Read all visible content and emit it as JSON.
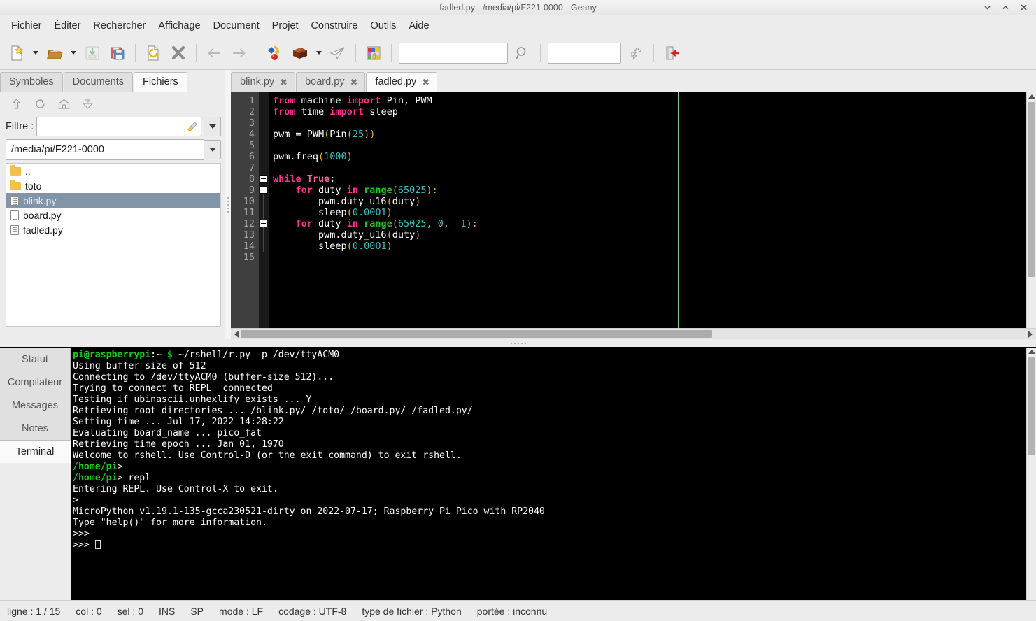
{
  "window": {
    "title": "fadled.py - /media/pi/F221-0000 - Geany",
    "controls": [
      {
        "name": "minimize-button",
        "glyph": "chevron-down-icon"
      },
      {
        "name": "maximize-button",
        "glyph": "chevron-up-icon"
      },
      {
        "name": "close-button",
        "glyph": "close-icon"
      }
    ]
  },
  "menubar": {
    "items": [
      {
        "label": "Fichier"
      },
      {
        "label": "Éditer"
      },
      {
        "label": "Rechercher"
      },
      {
        "label": "Affichage"
      },
      {
        "label": "Document"
      },
      {
        "label": "Projet"
      },
      {
        "label": "Construire"
      },
      {
        "label": "Outils"
      },
      {
        "label": "Aide"
      }
    ]
  },
  "toolbar": {
    "buttons": [
      {
        "name": "new-document-button",
        "icon": "new-file-icon"
      },
      {
        "name": "new-document-menu-button",
        "icon": "chevron-down-icon"
      },
      {
        "name": "open-document-button",
        "icon": "open-folder-icon"
      },
      {
        "name": "open-recent-menu-button",
        "icon": "chevron-down-icon"
      },
      {
        "name": "save-button",
        "icon": "save-icon"
      },
      {
        "name": "save-all-button",
        "icon": "save-all-icon"
      },
      {
        "name": "reload-button",
        "icon": "revert-icon"
      },
      {
        "name": "close-document-button",
        "icon": "close-x-icon"
      },
      {
        "name": "navigate-back-button",
        "icon": "arrow-left-icon"
      },
      {
        "name": "navigate-forward-button",
        "icon": "arrow-right-icon"
      },
      {
        "name": "compile-button",
        "icon": "compile-icon"
      },
      {
        "name": "build-button",
        "icon": "build-brick-icon"
      },
      {
        "name": "build-menu-button",
        "icon": "chevron-down-icon"
      },
      {
        "name": "run-button",
        "icon": "run-paperplane-icon"
      },
      {
        "name": "color-chooser-button",
        "icon": "color-palette-icon"
      },
      {
        "name": "quit-button",
        "icon": "quit-door-icon"
      }
    ],
    "search_entry": {
      "value": "",
      "placeholder": ""
    },
    "goto_entry": {
      "value": "",
      "placeholder": ""
    },
    "find_button": {
      "name": "find-icon"
    },
    "jump-to_button": {
      "name": "jump-to-icon"
    }
  },
  "sidebar": {
    "tabs": [
      {
        "label": "Symboles",
        "active": false
      },
      {
        "label": "Documents",
        "active": false
      },
      {
        "label": "Fichiers",
        "active": true
      }
    ],
    "toolbar_icons": [
      {
        "name": "go-up-icon"
      },
      {
        "name": "refresh-icon"
      },
      {
        "name": "home-icon"
      },
      {
        "name": "locate-current-file-icon"
      }
    ],
    "filter": {
      "label": "Filtre :",
      "value": "",
      "placeholder": ""
    },
    "path": {
      "value": "/media/pi/F221-0000"
    },
    "files": [
      {
        "name": "..",
        "type": "folder",
        "selected": false
      },
      {
        "name": "toto",
        "type": "folder",
        "selected": false
      },
      {
        "name": "blink.py",
        "type": "file",
        "selected": true
      },
      {
        "name": "board.py",
        "type": "file",
        "selected": false
      },
      {
        "name": "fadled.py",
        "type": "file",
        "selected": false
      }
    ]
  },
  "editor": {
    "tabs": [
      {
        "label": "blink.py",
        "active": false,
        "close": "✖"
      },
      {
        "label": "board.py",
        "active": false,
        "close": "✖"
      },
      {
        "label": "fadled.py",
        "active": true,
        "close": "✖"
      }
    ],
    "line_numbers": [
      "1",
      "2",
      "3",
      "4",
      "5",
      "6",
      "7",
      "8",
      "9",
      "10",
      "11",
      "12",
      "13",
      "14",
      "15"
    ],
    "code_lines": [
      {
        "n": 1,
        "tokens": [
          {
            "t": "from",
            "c": "kw"
          },
          {
            "t": " machine ",
            "c": "plain"
          },
          {
            "t": "import",
            "c": "kw"
          },
          {
            "t": " Pin, PWM",
            "c": "plain"
          }
        ]
      },
      {
        "n": 2,
        "tokens": [
          {
            "t": "from",
            "c": "kw"
          },
          {
            "t": " time ",
            "c": "plain"
          },
          {
            "t": "import",
            "c": "kw"
          },
          {
            "t": " sleep",
            "c": "plain"
          }
        ]
      },
      {
        "n": 3,
        "tokens": []
      },
      {
        "n": 4,
        "tokens": [
          {
            "t": "pwm = PWM",
            "c": "plain"
          },
          {
            "t": "(",
            "c": "op"
          },
          {
            "t": "Pin",
            "c": "plain"
          },
          {
            "t": "(",
            "c": "op"
          },
          {
            "t": "25",
            "c": "num"
          },
          {
            "t": "))",
            "c": "op"
          }
        ]
      },
      {
        "n": 5,
        "tokens": []
      },
      {
        "n": 6,
        "tokens": [
          {
            "t": "pwm.freq",
            "c": "plain"
          },
          {
            "t": "(",
            "c": "op"
          },
          {
            "t": "1000",
            "c": "num"
          },
          {
            "t": ")",
            "c": "op"
          }
        ]
      },
      {
        "n": 7,
        "tokens": []
      },
      {
        "n": 8,
        "tokens": [
          {
            "t": "while",
            "c": "kw"
          },
          {
            "t": " ",
            "c": "plain"
          },
          {
            "t": "True",
            "c": "kw2"
          },
          {
            "t": ":",
            "c": "plain"
          }
        ]
      },
      {
        "n": 9,
        "tokens": [
          {
            "t": "    ",
            "c": "plain"
          },
          {
            "t": "for",
            "c": "kw"
          },
          {
            "t": " duty ",
            "c": "plain"
          },
          {
            "t": "in",
            "c": "kw"
          },
          {
            "t": " ",
            "c": "plain"
          },
          {
            "t": "range",
            "c": "bi"
          },
          {
            "t": "(",
            "c": "op"
          },
          {
            "t": "65025",
            "c": "num"
          },
          {
            "t": "):",
            "c": "op"
          }
        ]
      },
      {
        "n": 10,
        "tokens": [
          {
            "t": "        pwm.duty_u16",
            "c": "plain"
          },
          {
            "t": "(",
            "c": "op"
          },
          {
            "t": "duty",
            "c": "plain"
          },
          {
            "t": ")",
            "c": "op"
          }
        ]
      },
      {
        "n": 11,
        "tokens": [
          {
            "t": "        sleep",
            "c": "plain"
          },
          {
            "t": "(",
            "c": "op"
          },
          {
            "t": "0.0001",
            "c": "num"
          },
          {
            "t": ")",
            "c": "op"
          }
        ]
      },
      {
        "n": 12,
        "tokens": [
          {
            "t": "    ",
            "c": "plain"
          },
          {
            "t": "for",
            "c": "kw"
          },
          {
            "t": " duty ",
            "c": "plain"
          },
          {
            "t": "in",
            "c": "kw"
          },
          {
            "t": " ",
            "c": "plain"
          },
          {
            "t": "range",
            "c": "bi"
          },
          {
            "t": "(",
            "c": "op"
          },
          {
            "t": "65025",
            "c": "num"
          },
          {
            "t": ", ",
            "c": "op"
          },
          {
            "t": "0",
            "c": "num"
          },
          {
            "t": ", ",
            "c": "op"
          },
          {
            "t": "-1",
            "c": "num"
          },
          {
            "t": "):",
            "c": "op"
          }
        ]
      },
      {
        "n": 13,
        "tokens": [
          {
            "t": "        pwm.duty_u16",
            "c": "plain"
          },
          {
            "t": "(",
            "c": "op"
          },
          {
            "t": "duty",
            "c": "plain"
          },
          {
            "t": ")",
            "c": "op"
          }
        ]
      },
      {
        "n": 14,
        "tokens": [
          {
            "t": "        sleep",
            "c": "plain"
          },
          {
            "t": "(",
            "c": "op"
          },
          {
            "t": "0.0001",
            "c": "num"
          },
          {
            "t": ")",
            "c": "op"
          }
        ]
      },
      {
        "n": 15,
        "tokens": []
      }
    ],
    "fold_markers": [
      8,
      9,
      12
    ],
    "edge_marker_color": "#7fd07f"
  },
  "message_panel": {
    "tabs": [
      {
        "label": "Statut",
        "active": false
      },
      {
        "label": "Compilateur",
        "active": false
      },
      {
        "label": "Messages",
        "active": false
      },
      {
        "label": "Notes",
        "active": false
      },
      {
        "label": "Terminal",
        "active": true
      }
    ],
    "terminal_lines": [
      [
        {
          "t": "pi@raspberrypi",
          "c": "green"
        },
        {
          "t": ":~ ",
          "c": "plain"
        },
        {
          "t": "$",
          "c": "green"
        },
        {
          "t": " ~/rshell/r.py -p /dev/ttyACM0",
          "c": "plain"
        }
      ],
      [
        {
          "t": "Using buffer-size of 512",
          "c": "plain"
        }
      ],
      [
        {
          "t": "Connecting to /dev/ttyACM0 (buffer-size 512)...",
          "c": "plain"
        }
      ],
      [
        {
          "t": "Trying to connect to REPL  connected",
          "c": "plain"
        }
      ],
      [
        {
          "t": "Testing if ubinascii.unhexlify exists ... Y",
          "c": "plain"
        }
      ],
      [
        {
          "t": "Retrieving root directories ... /blink.py/ /toto/ /board.py/ /fadled.py/",
          "c": "plain"
        }
      ],
      [
        {
          "t": "Setting time ... Jul 17, 2022 14:28:22",
          "c": "plain"
        }
      ],
      [
        {
          "t": "Evaluating board_name ... pico_fat",
          "c": "plain"
        }
      ],
      [
        {
          "t": "Retrieving time epoch ... Jan 01, 1970",
          "c": "plain"
        }
      ],
      [
        {
          "t": "Welcome to rshell. Use Control-D (or the exit command) to exit rshell.",
          "c": "plain"
        }
      ],
      [
        {
          "t": "/home/pi",
          "c": "green"
        },
        {
          "t": ">",
          "c": "plain"
        }
      ],
      [
        {
          "t": "/home/pi",
          "c": "green"
        },
        {
          "t": "> repl",
          "c": "plain"
        }
      ],
      [
        {
          "t": "Entering REPL. Use Control-X to exit.",
          "c": "plain"
        }
      ],
      [
        {
          "t": ">",
          "c": "plain"
        }
      ],
      [
        {
          "t": "MicroPython v1.19.1-135-gcca230521-dirty on 2022-07-17; Raspberry Pi Pico with RP2040",
          "c": "plain"
        }
      ],
      [
        {
          "t": "Type \"help()\" for more information.",
          "c": "plain"
        }
      ],
      [
        {
          "t": ">>>",
          "c": "plain"
        }
      ],
      [
        {
          "t": ">>> ",
          "c": "plain"
        },
        {
          "t": "",
          "c": "cursor"
        }
      ]
    ]
  },
  "statusbar": {
    "items": [
      "ligne : 1 / 15",
      "col : 0",
      "sel : 0",
      "INS",
      "SP",
      "mode : LF",
      "codage : UTF-8",
      "type de fichier : Python",
      "portée : inconnu"
    ]
  },
  "colors": {
    "chrome": "#ececec",
    "editor_bg": "#000000",
    "gutter_bg": "#3f3f3f",
    "selection": "#8294a8",
    "terminal_green": "#19c819",
    "keyword_pink": "#ff2f92",
    "builtin_green": "#25c425",
    "number_cyan": "#3fbfbf",
    "operator_gold": "#e6b422"
  }
}
